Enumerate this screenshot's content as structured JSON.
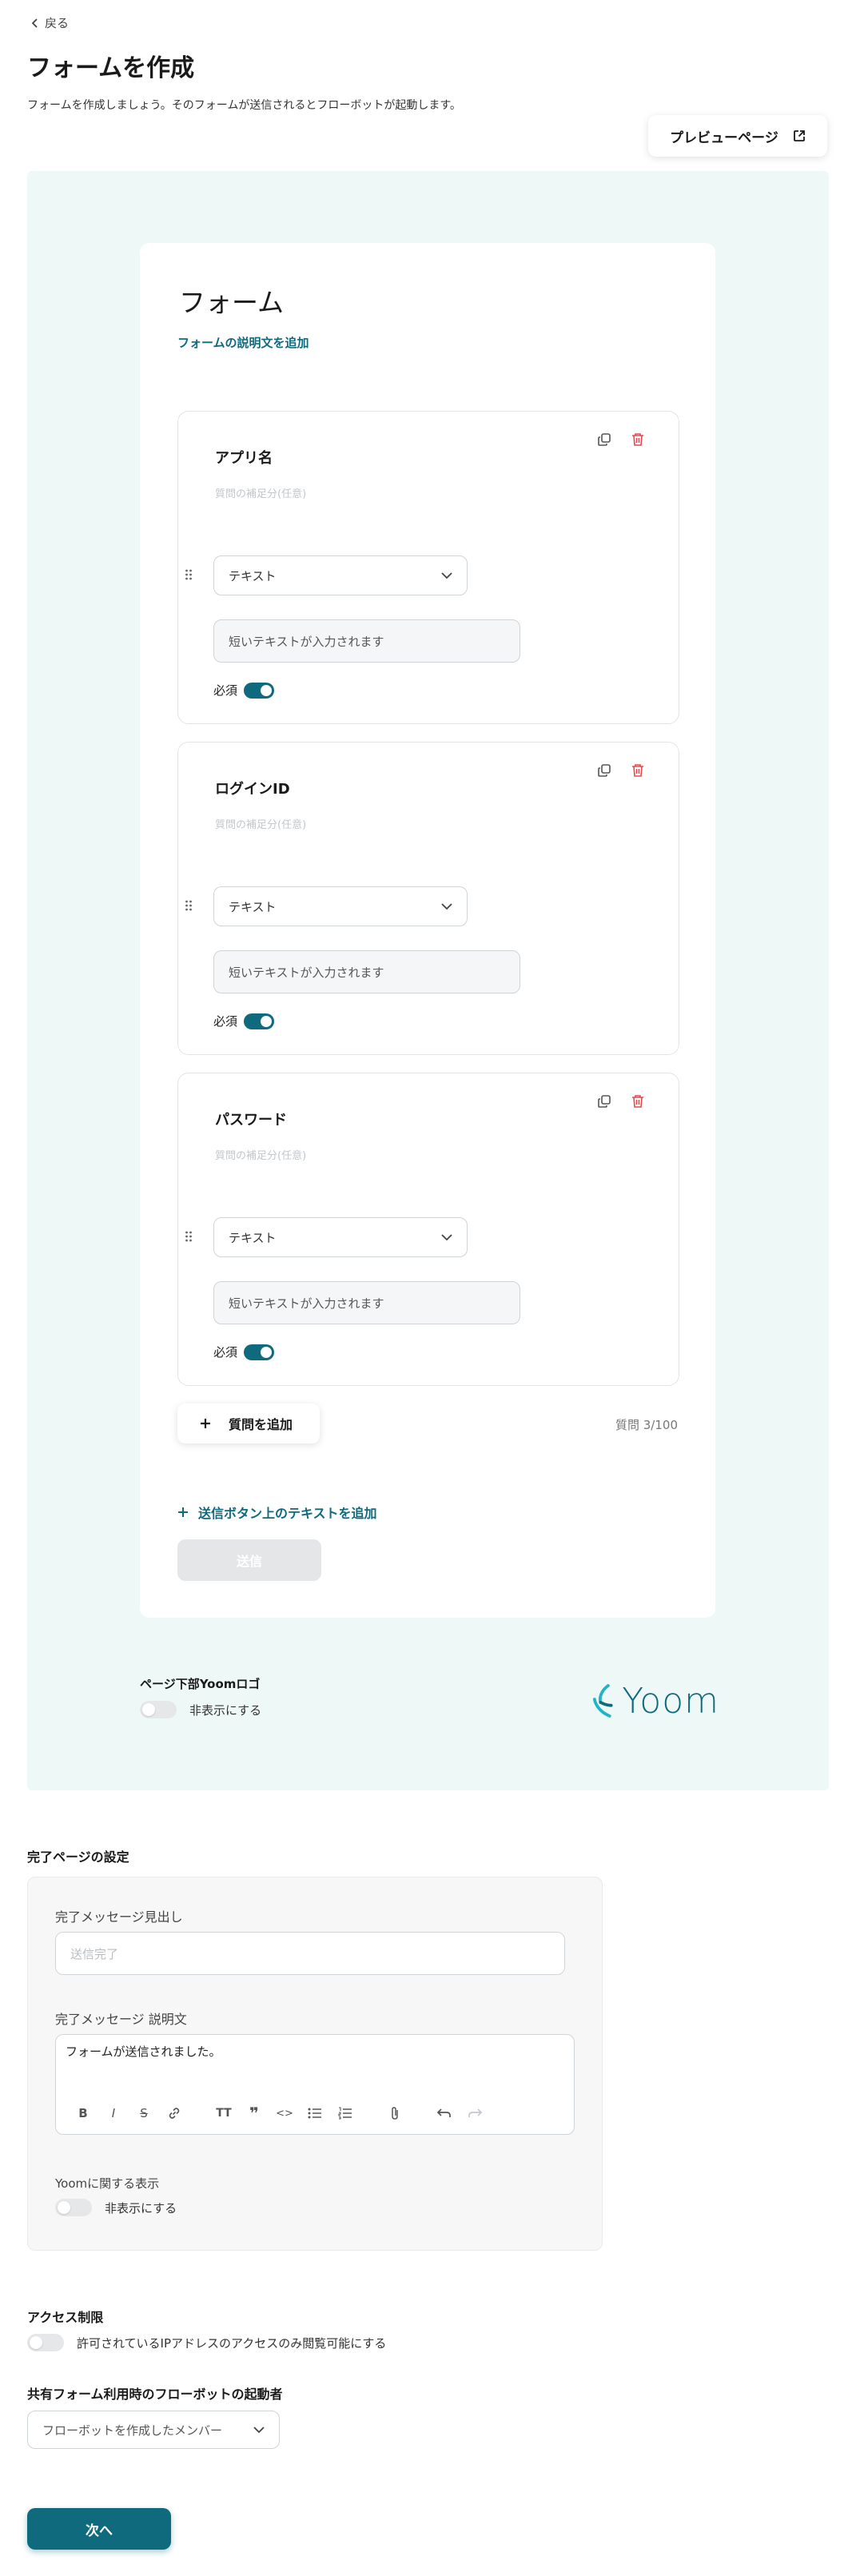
{
  "nav": {
    "back_label": "戻る"
  },
  "header": {
    "title": "フォームを作成",
    "description": "フォームを作成しましょう。そのフォームが送信されるとフローボットが起動します。",
    "preview_label": "プレビューページ"
  },
  "form": {
    "title": "フォーム",
    "add_description_label": "フォームの説明文を追加",
    "questions": [
      {
        "title": "アプリ名",
        "hint": "質問の補足分(任意)",
        "type": "テキスト",
        "placeholder": "短いテキストが入力されます",
        "required_label": "必須",
        "required": true
      },
      {
        "title": "ログインID",
        "hint": "質問の補足分(任意)",
        "type": "テキスト",
        "placeholder": "短いテキストが入力されます",
        "required_label": "必須",
        "required": true
      },
      {
        "title": "パスワード",
        "hint": "質問の補足分(任意)",
        "type": "テキスト",
        "placeholder": "短いテキストが入力されます",
        "required_label": "必須",
        "required": true
      }
    ],
    "add_question_label": "質問を追加",
    "question_count": "質問 3/100",
    "add_submit_text_label": "送信ボタン上のテキストを追加",
    "submit_label": "送信"
  },
  "logo_setting": {
    "label": "ページ下部Yoomロゴ",
    "toggle_label": "非表示にする",
    "hidden": false,
    "logo_text": "Yoom"
  },
  "complete_page": {
    "section_title": "完了ページの設定",
    "heading_label": "完了メッセージ見出し",
    "heading_placeholder": "送信完了",
    "desc_label": "完了メッセージ 説明文",
    "desc_value": "フォームが送信されました。",
    "yoom_label": "Yoomに関する表示",
    "yoom_toggle_label": "非表示にする",
    "yoom_hidden": false,
    "toolbar": [
      "bold-icon",
      "italic-icon",
      "strikethrough-icon",
      "link-icon",
      "heading-icon",
      "quote-icon",
      "code-icon",
      "bullet-list-icon",
      "numbered-list-icon",
      "attachment-icon",
      "undo-icon",
      "redo-icon"
    ]
  },
  "access": {
    "section_title": "アクセス制限",
    "toggle_label": "許可されているIPアドレスのアクセスのみ閲覧可能にする",
    "enabled": false
  },
  "shared_form": {
    "section_title": "共有フォーム利用時のフローボットの起動者",
    "selected": "フローボットを作成したメンバー"
  },
  "footer": {
    "next_label": "次へ"
  },
  "colors": {
    "accent": "#0f6a7d",
    "preview_bg": "#eef9f7",
    "delete": "#e5484d",
    "logo_mark": "#1fb5c7"
  }
}
